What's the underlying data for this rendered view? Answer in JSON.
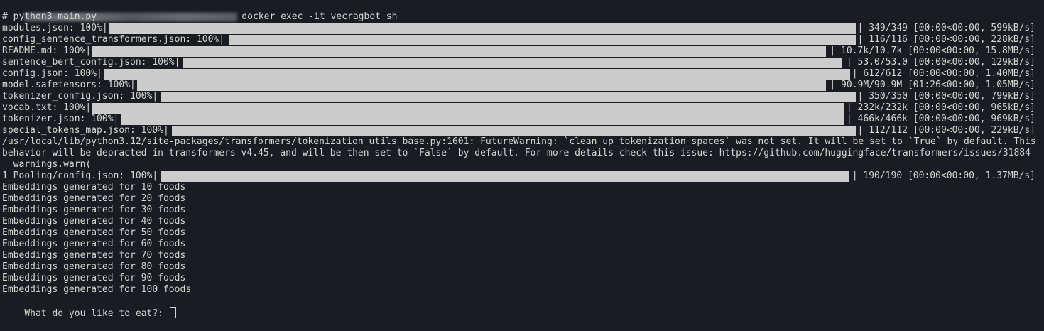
{
  "prompt": {
    "command": "docker exec -it vecragbot sh"
  },
  "shell": {
    "command_line": "# python3 main.py"
  },
  "downloads": [
    {
      "label": "modules.json: 100%|",
      "stats": "| 349/349 [00:00<00:00, 599kB/s]",
      "bar_start": 153,
      "bar_end": 1205
    },
    {
      "label": "config_sentence_transformers.json: 100%|",
      "stats": "| 116/116 [00:00<00:00, 228kB/s]",
      "bar_start": 323,
      "bar_end": 1205
    },
    {
      "label": "README.md: 100%|",
      "stats": "| 10.7k/10.7k [00:00<00:00, 15.8MB/s]",
      "bar_start": 129,
      "bar_end": 1163
    },
    {
      "label": "sentence_bert_config.json: 100%|",
      "stats": "| 53.0/53.0 [00:00<00:00, 129kB/s]",
      "bar_start": 258,
      "bar_end": 1186
    },
    {
      "label": "config.json: 100%|",
      "stats": "| 612/612 [00:00<00:00, 1.40MB/s]",
      "bar_start": 146,
      "bar_end": 1197
    },
    {
      "label": "model.safetensors: 100%|",
      "stats": "| 90.9M/90.9M [01:26<00:00, 1.05MB/s]",
      "bar_start": 193,
      "bar_end": 1163
    },
    {
      "label": "tokenizer_config.json: 100%|",
      "stats": "| 350/350 [00:00<00:00, 799kB/s]",
      "bar_start": 226,
      "bar_end": 1205
    },
    {
      "label": "vocab.txt: 100%|",
      "stats": "| 232k/232k [00:00<00:00, 965kB/s]",
      "bar_start": 130,
      "bar_end": 1189
    },
    {
      "label": "tokenizer.json: 100%|",
      "stats": "| 466k/466k [00:00<00:00, 969kB/s]",
      "bar_start": 170,
      "bar_end": 1189
    },
    {
      "label": "special_tokens_map.json: 100%|",
      "stats": "| 112/112 [00:00<00:00, 229kB/s]",
      "bar_start": 242,
      "bar_end": 1205
    }
  ],
  "warning": {
    "text": "/usr/local/lib/python3.12/site-packages/transformers/tokenization_utils_base.py:1601: FutureWarning: `clean_up_tokenization_spaces` was not set. It will be set to `True` by default. This behavior will be depracted in transformers v4.45, and will be then set to `False` by default. For more details check this issue: https://github.com/huggingface/transformers/issues/31884",
    "warn_call": "  warnings.warn("
  },
  "pooling": {
    "label": "1_Pooling/config.json: 100%|",
    "stats": "| 190/190 [00:00<00:00, 1.37MB/s]",
    "bar_start": 226,
    "bar_end": 1195
  },
  "embeddings": [
    "Embeddings generated for 10 foods",
    "Embeddings generated for 20 foods",
    "Embeddings generated for 30 foods",
    "Embeddings generated for 40 foods",
    "Embeddings generated for 50 foods",
    "Embeddings generated for 60 foods",
    "Embeddings generated for 70 foods",
    "Embeddings generated for 80 foods",
    "Embeddings generated for 90 foods",
    "Embeddings generated for 100 foods"
  ],
  "input": {
    "prompt": "What do you like to eat?: "
  },
  "colors": {
    "background": "#1a1c24",
    "foreground": "#d3d7cf",
    "progress_fill": "#cccccc"
  }
}
